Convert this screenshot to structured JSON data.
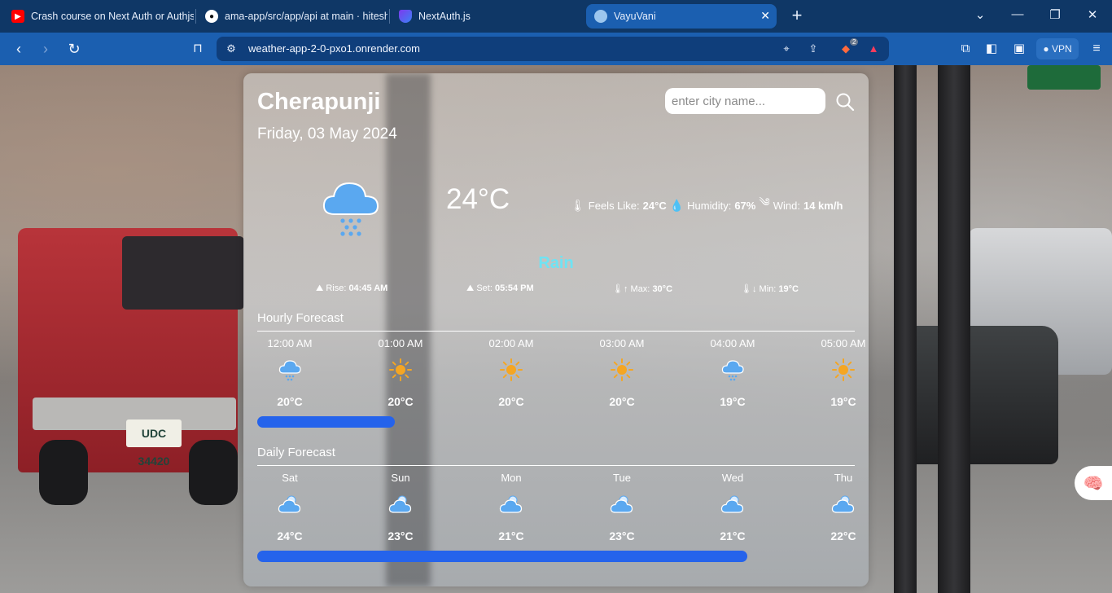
{
  "browser": {
    "tabs": [
      {
        "title": "Crash course on Next Auth or Authjs",
        "icon": "youtube-icon",
        "active": false
      },
      {
        "title": "ama-app/src/app/api at main · hitesh",
        "icon": "github-icon",
        "active": false
      },
      {
        "title": "NextAuth.js",
        "icon": "nextauth-icon",
        "active": false
      },
      {
        "title": "VayuVani",
        "icon": "vayuvani-icon",
        "active": true
      }
    ],
    "url": "weather-app-2-0-pxo1.onrender.com",
    "vpn_label": "VPN",
    "brave_badge": "2"
  },
  "weather": {
    "city": "Cherapunji",
    "date": "Friday, 03 May 2024",
    "search_placeholder": "enter city name...",
    "temperature": "24°C",
    "condition": "Rain",
    "details": {
      "feels_like_label": "Feels Like:",
      "feels_like": "24°C",
      "humidity_label": "Humidity:",
      "humidity": "67%",
      "wind_label": "Wind:",
      "wind": "14 km/h"
    },
    "sun": {
      "rise_label": "Rise:",
      "rise": "04:45 AM",
      "set_label": "Set:",
      "set": "05:54 PM",
      "max_label": "Max:",
      "max": "30°C",
      "min_label": "Min:",
      "min": "19°C"
    },
    "hourly_title": "Hourly Forecast",
    "hourly": [
      {
        "label": "12:00 AM",
        "icon": "rain-cloud",
        "temp": "20°C"
      },
      {
        "label": "01:00 AM",
        "icon": "sun",
        "temp": "20°C"
      },
      {
        "label": "02:00 AM",
        "icon": "sun",
        "temp": "20°C"
      },
      {
        "label": "03:00 AM",
        "icon": "sun",
        "temp": "20°C"
      },
      {
        "label": "04:00 AM",
        "icon": "rain-cloud",
        "temp": "19°C"
      },
      {
        "label": "05:00 AM",
        "icon": "sun",
        "temp": "19°C"
      }
    ],
    "daily_title": "Daily Forecast",
    "daily": [
      {
        "label": "Sat",
        "icon": "sun-cloud",
        "temp": "24°C"
      },
      {
        "label": "Sun",
        "icon": "sun-cloud",
        "temp": "23°C"
      },
      {
        "label": "Mon",
        "icon": "sun-cloud",
        "temp": "21°C"
      },
      {
        "label": "Tue",
        "icon": "sun-cloud",
        "temp": "23°C"
      },
      {
        "label": "Wed",
        "icon": "sun-cloud",
        "temp": "21°C"
      },
      {
        "label": "Thu",
        "icon": "sun-cloud",
        "temp": "22°C"
      }
    ],
    "hourly_scroll_fraction": 0.23,
    "daily_scroll_fraction": 0.82
  },
  "colors": {
    "tabbar": "#0f3766",
    "toolbar": "#1b5fb0",
    "accent_scrollbar": "#2563eb",
    "condition_text": "#6fe3f3",
    "sun_icon": "#f5a623",
    "cloud_icon": "#5aa8f0"
  }
}
